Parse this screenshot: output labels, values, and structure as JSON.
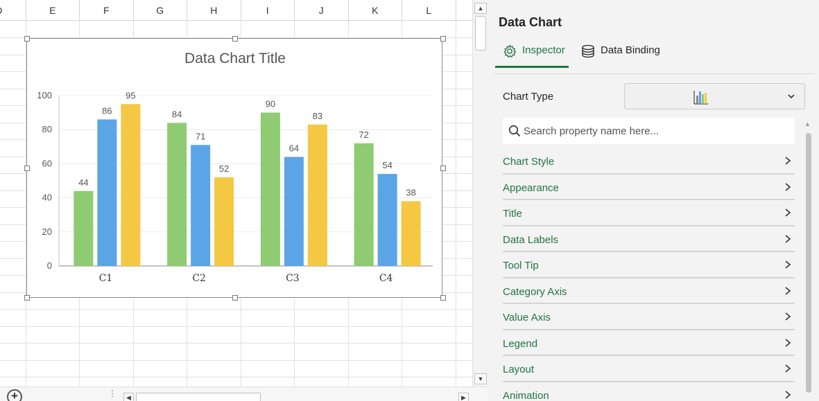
{
  "sheet": {
    "columns": [
      "D",
      "E",
      "F",
      "G",
      "H",
      "I",
      "J",
      "K",
      "L"
    ]
  },
  "chart_data": {
    "type": "bar",
    "title": "Data Chart Title",
    "categories": [
      "C1",
      "C2",
      "C3",
      "C4"
    ],
    "series": [
      {
        "values": [
          44,
          84,
          90,
          72
        ],
        "color": "#8fcb72"
      },
      {
        "values": [
          86,
          71,
          64,
          54
        ],
        "color": "#5ba4e5"
      },
      {
        "values": [
          95,
          52,
          83,
          38
        ],
        "color": "#f4c843"
      }
    ],
    "ylim": [
      0,
      100
    ],
    "yticks": [
      0,
      20,
      40,
      60,
      80,
      100
    ],
    "grid": true,
    "legend": "none"
  },
  "panel": {
    "title": "Data Chart",
    "tabs": [
      {
        "label": "Inspector",
        "icon": "gear-icon",
        "active": true
      },
      {
        "label": "Data Binding",
        "icon": "database-icon",
        "active": false
      }
    ],
    "chart_type_label": "Chart Type",
    "chart_type_icon": "bar-chart-icon",
    "search_placeholder": "Search property name here...",
    "properties": [
      "Chart Style",
      "Appearance",
      "Title",
      "Data Labels",
      "Tool Tip",
      "Category Axis",
      "Value Axis",
      "Legend",
      "Layout",
      "Animation"
    ]
  },
  "colors": {
    "accent": "#217346"
  }
}
